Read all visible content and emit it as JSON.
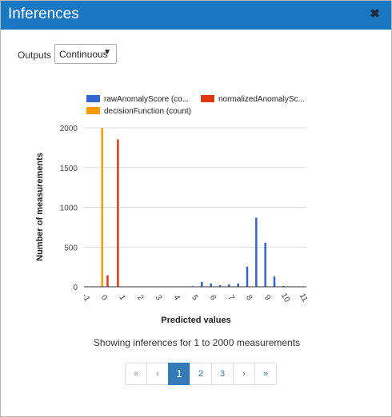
{
  "dialog": {
    "title": "Inferences",
    "close_icon": "close-icon"
  },
  "outputs": {
    "label": "Outputs",
    "selected": "Continuous"
  },
  "chart_data": {
    "type": "bar",
    "xlabel": "Predicted values",
    "ylabel": "Number of measurements",
    "xlim": [
      -1,
      11
    ],
    "ylim": [
      0,
      2000
    ],
    "xticks": [
      "-1",
      "0",
      "1",
      "2",
      "3",
      "4",
      "5",
      "6",
      "7",
      "8",
      "9",
      "10",
      "11"
    ],
    "yticks": [
      "0",
      "500",
      "1000",
      "1500",
      "2000"
    ],
    "grid": true,
    "legend_position": "top",
    "series": [
      {
        "name": "rawAnomalyScore (co...",
        "color": "#3366cc",
        "x": [
          5.0,
          5.5,
          6.0,
          6.5,
          7.0,
          7.5,
          8.0,
          8.5,
          9.0,
          9.5,
          10.0
        ],
        "values": [
          8,
          62,
          42,
          22,
          30,
          42,
          255,
          870,
          555,
          130,
          10
        ]
      },
      {
        "name": "normalizedAnomalySc...",
        "color": "#dc3912",
        "x": [
          0.3,
          0.87
        ],
        "values": [
          145,
          1855
        ]
      },
      {
        "name": "decisionFunction (count)",
        "color": "#ff9900",
        "x": [
          0.0
        ],
        "values": [
          2000
        ]
      }
    ]
  },
  "status": "Showing inferences for 1 to 2000 measurements",
  "pagination": {
    "first": "«",
    "prev": "‹",
    "pages": [
      "1",
      "2",
      "3"
    ],
    "active": "1",
    "next": "›",
    "last": "»"
  }
}
